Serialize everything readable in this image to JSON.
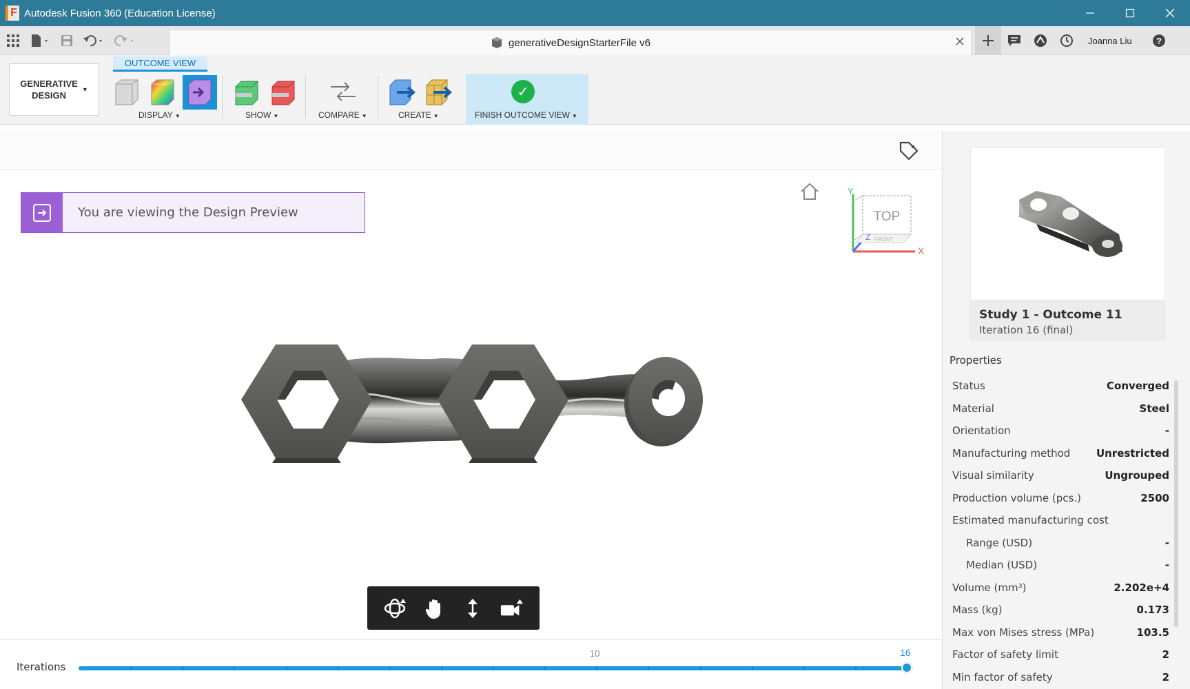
{
  "window": {
    "title": "Autodesk Fusion 360 (Education License)",
    "controls": [
      "minimize",
      "maximize",
      "close"
    ]
  },
  "quick_access": {
    "document_title": "generativeDesignStarterFile v6",
    "user_name": "Joanna Liu"
  },
  "ribbon": {
    "workspace_label": "GENERATIVE\nDESIGN",
    "active_tab": "OUTCOME VIEW",
    "groups": {
      "display": "DISPLAY",
      "show": "SHOW",
      "compare": "COMPARE",
      "create": "CREATE",
      "finish": "FINISH OUTCOME VIEW"
    }
  },
  "canvas": {
    "banner_text": "You are viewing the Design Preview",
    "viewcube_face": "TOP",
    "viewcube_front": "FRONT",
    "axes": {
      "x": "X",
      "y": "Y",
      "z": "Z"
    }
  },
  "timeline": {
    "label": "Iterations",
    "mid_tick": "10",
    "current": "16",
    "progress": 1.0
  },
  "outcome": {
    "name": "Study 1 - Outcome 11",
    "iteration": "Iteration 16 (final)"
  },
  "properties": {
    "title": "Properties",
    "rows": [
      {
        "k": "Status",
        "v": "Converged"
      },
      {
        "k": "Material",
        "v": "Steel"
      },
      {
        "k": "Orientation",
        "v": "-"
      },
      {
        "k": "Manufacturing method",
        "v": "Unrestricted"
      },
      {
        "k": "Visual similarity",
        "v": "Ungrouped"
      },
      {
        "k": "Production volume (pcs.)",
        "v": "2500"
      },
      {
        "k": "Estimated manufacturing cost",
        "v": ""
      },
      {
        "k": "Range (USD)",
        "v": "-"
      },
      {
        "k": "Median (USD)",
        "v": "-"
      },
      {
        "k": "Volume (mm³)",
        "v": "2.202e+4"
      },
      {
        "k": "Mass (kg)",
        "v": "0.173"
      },
      {
        "k": "Max von Mises stress (MPa)",
        "v": "103.5"
      },
      {
        "k": "Factor of safety limit",
        "v": "2"
      },
      {
        "k": "Min factor of safety",
        "v": "2"
      }
    ]
  },
  "colors": {
    "titlebar": "#2d7b98",
    "accent": "#1a9ad6",
    "preview_purple": "#9b5fd6",
    "finish_green": "#1cb14a"
  }
}
